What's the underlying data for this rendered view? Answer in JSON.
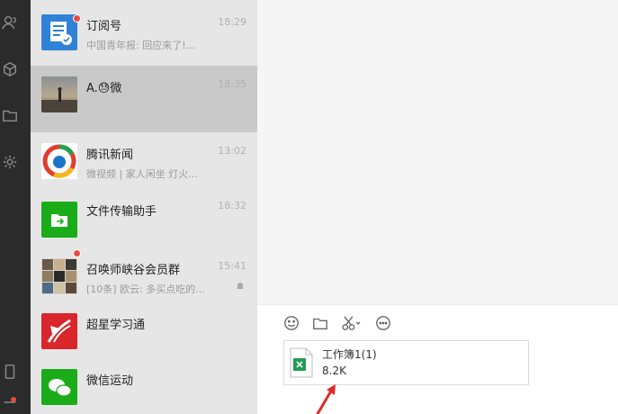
{
  "chats": [
    {
      "name": "订阅号",
      "preview": "中国青年报: 回应来了!...",
      "time": "18:29"
    },
    {
      "name": "A.😓微",
      "preview": "",
      "time": "18:35"
    },
    {
      "name": "腾讯新闻",
      "preview": "微视频 | 家人闲坐 灯火...",
      "time": "13:02"
    },
    {
      "name": "文件传输助手",
      "preview": "",
      "time": "18:32"
    },
    {
      "name": "召唤师峡谷会员群",
      "preview": "[10条] 欧云: 多买点吃的...",
      "time": "15:41"
    },
    {
      "name": "超星学习通",
      "preview": "",
      "time": ""
    },
    {
      "name": "微信运动",
      "preview": "",
      "time": ""
    }
  ],
  "attachment": {
    "name": "工作簿1(1)",
    "size": "8.2K"
  },
  "colors": {
    "accent_green": "#1aad19",
    "badge_red": "#f04a3e",
    "arrow_red": "#e02a2a"
  }
}
